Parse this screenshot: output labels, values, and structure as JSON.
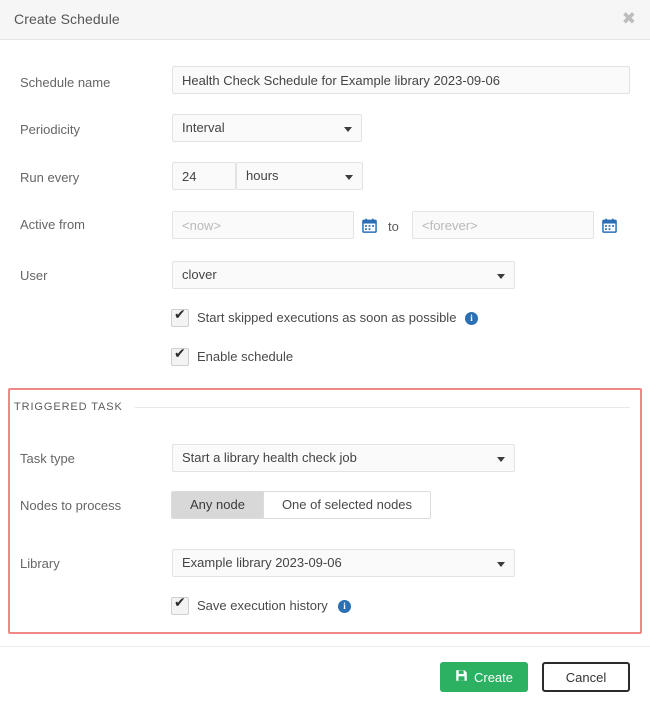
{
  "dialog": {
    "title": "Create Schedule",
    "close_icon": "close-icon"
  },
  "form": {
    "schedule_name": {
      "label": "Schedule name",
      "value": "Health Check Schedule for Example library 2023-09-06"
    },
    "periodicity": {
      "label": "Periodicity",
      "value": "Interval"
    },
    "run_every": {
      "label": "Run every",
      "amount": "24",
      "unit": "hours"
    },
    "active_from": {
      "label": "Active from",
      "from_placeholder": "<now>",
      "to_label": "to",
      "to_placeholder": "<forever>",
      "calendar_icon": "calendar-icon"
    },
    "user": {
      "label": "User",
      "value": "clover"
    },
    "start_skipped": {
      "label": "Start skipped executions as soon as possible",
      "checked": true,
      "info_icon": "info-icon"
    },
    "enable_schedule": {
      "label": "Enable schedule",
      "checked": true
    }
  },
  "triggered_task": {
    "legend": "TRIGGERED TASK",
    "task_type": {
      "label": "Task type",
      "value": "Start a library health check job"
    },
    "nodes_to_process": {
      "label": "Nodes to process",
      "options": [
        "Any node",
        "One of selected nodes"
      ],
      "selected": "Any node"
    },
    "library": {
      "label": "Library",
      "value": "Example library 2023-09-06"
    },
    "save_history": {
      "label": "Save execution history",
      "checked": true,
      "info_icon": "info-icon"
    }
  },
  "footer": {
    "create_label": "Create",
    "create_icon": "save-icon",
    "cancel_label": "Cancel"
  },
  "colors": {
    "panel_border": "#ef8888",
    "create_button": "#2bb161",
    "info_icon": "#2b6fb5",
    "header_bg": "#f6f6f6"
  }
}
